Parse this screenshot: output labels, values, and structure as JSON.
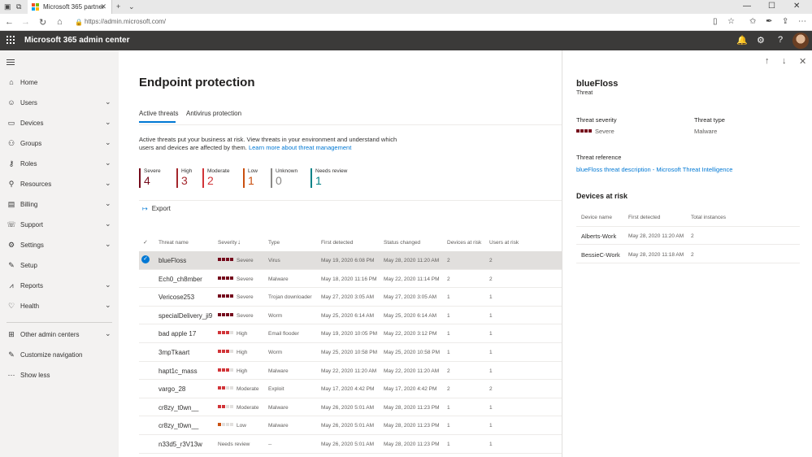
{
  "browser": {
    "tab_title": "Microsoft 365 partner",
    "url": "https://admin.microsoft.com/"
  },
  "header": {
    "app_title": "Microsoft 365 admin center"
  },
  "nav": {
    "items": [
      {
        "label": "Home",
        "icon": "home-icon",
        "glyph": "⌂",
        "chevron": false
      },
      {
        "label": "Users",
        "icon": "user-icon",
        "glyph": "☺",
        "chevron": true
      },
      {
        "label": "Devices",
        "icon": "devices-icon",
        "glyph": "▭",
        "chevron": true
      },
      {
        "label": "Groups",
        "icon": "groups-icon",
        "glyph": "⚇",
        "chevron": true
      },
      {
        "label": "Roles",
        "icon": "roles-icon",
        "glyph": "⚷",
        "chevron": true
      },
      {
        "label": "Resources",
        "icon": "resources-icon",
        "glyph": "⚲",
        "chevron": true
      },
      {
        "label": "Billing",
        "icon": "billing-icon",
        "glyph": "▤",
        "chevron": true
      },
      {
        "label": "Support",
        "icon": "support-icon",
        "glyph": "☏",
        "chevron": true
      },
      {
        "label": "Settings",
        "icon": "settings-icon",
        "glyph": "⚙",
        "chevron": true
      },
      {
        "label": "Setup",
        "icon": "setup-icon",
        "glyph": "✎",
        "chevron": false
      },
      {
        "label": "Reports",
        "icon": "reports-icon",
        "glyph": "⩘",
        "chevron": true
      },
      {
        "label": "Health",
        "icon": "health-icon",
        "glyph": "♡",
        "chevron": true
      },
      {
        "label": "Other admin centers",
        "icon": "admin-centers-icon",
        "glyph": "⊞",
        "chevron": true
      },
      {
        "label": "Customize navigation",
        "icon": "pencil-icon",
        "glyph": "✎",
        "chevron": false
      },
      {
        "label": "Show less",
        "icon": "ellipsis-icon",
        "glyph": "⋯",
        "chevron": false
      }
    ]
  },
  "main": {
    "title": "Endpoint protection",
    "tabs": [
      "Active threats",
      "Antivirus protection"
    ],
    "description": "Active threats put your business at risk. View threats in your environment and understand which users and devices are affected by them.",
    "description_link": "Learn more about threat management",
    "kpis": [
      {
        "label": "Severe",
        "value": "4",
        "color": "#750b1c"
      },
      {
        "label": "High",
        "value": "3",
        "color": "#a4262c"
      },
      {
        "label": "Moderate",
        "value": "2",
        "color": "#d13438"
      },
      {
        "label": "Low",
        "value": "1",
        "color": "#ca5010"
      },
      {
        "label": "Unknown",
        "value": "0",
        "color": "#8a8886"
      },
      {
        "label": "Needs review",
        "value": "1",
        "color": "#038387"
      }
    ],
    "export_label": "Export",
    "columns": [
      "Threat name",
      "Severity",
      "Type",
      "First detected",
      "Status changed",
      "Devices at risk",
      "Users at risk"
    ],
    "sort_indicator": "↓",
    "rows": [
      {
        "name": "blueFloss",
        "severity": "Severe",
        "level": 4,
        "color": "#750b1c",
        "type": "Virus",
        "first": "May 19, 2020 6:08 PM",
        "status": "May 28, 2020 11:20 AM",
        "devices": "2",
        "users": "2",
        "selected": true
      },
      {
        "name": "Ech0_ch8mber",
        "severity": "Severe",
        "level": 4,
        "color": "#750b1c",
        "type": "Malware",
        "first": "May 18, 2020 11:16 PM",
        "status": "May 22, 2020 11:14 PM",
        "devices": "2",
        "users": "2",
        "selected": false
      },
      {
        "name": "Vericose253",
        "severity": "Severe",
        "level": 4,
        "color": "#750b1c",
        "type": "Trojan downloader",
        "first": "May 27, 2020 3:05 AM",
        "status": "May 27, 2020 3:05 AM",
        "devices": "1",
        "users": "1",
        "selected": false
      },
      {
        "name": "specialDelivery_ji9",
        "severity": "Severe",
        "level": 4,
        "color": "#750b1c",
        "type": "Worm",
        "first": "May 25, 2020 6:14 AM",
        "status": "May 25, 2020 6:14 AM",
        "devices": "1",
        "users": "1",
        "selected": false
      },
      {
        "name": "bad apple 17",
        "severity": "High",
        "level": 3,
        "color": "#d13438",
        "type": "Email flooder",
        "first": "May 19, 2020 10:05 PM",
        "status": "May 22, 2020 3:12 PM",
        "devices": "1",
        "users": "1",
        "selected": false
      },
      {
        "name": "3mpTkaart",
        "severity": "High",
        "level": 3,
        "color": "#d13438",
        "type": "Worm",
        "first": "May 25, 2020 10:58 PM",
        "status": "May 25, 2020 10:58 PM",
        "devices": "1",
        "users": "1",
        "selected": false
      },
      {
        "name": "hapt1c_mass",
        "severity": "High",
        "level": 3,
        "color": "#d13438",
        "type": "Malware",
        "first": "May 22, 2020 11:20 AM",
        "status": "May 22, 2020 11:20 AM",
        "devices": "2",
        "users": "1",
        "selected": false
      },
      {
        "name": "vargo_28",
        "severity": "Moderate",
        "level": 2,
        "color": "#d13438",
        "type": "Exploit",
        "first": "May 17, 2020 4:42 PM",
        "status": "May 17, 2020 4:42 PM",
        "devices": "2",
        "users": "2",
        "selected": false
      },
      {
        "name": "cr8zy_t0wn__",
        "severity": "Moderate",
        "level": 2,
        "color": "#d13438",
        "type": "Malware",
        "first": "May 26, 2020 5:01 AM",
        "status": "May 28, 2020 11:23 PM",
        "devices": "1",
        "users": "1",
        "selected": false
      },
      {
        "name": "cr8zy_t0wn__",
        "severity": "Low",
        "level": 1,
        "color": "#ca5010",
        "type": "Malware",
        "first": "May 26, 2020 5:01 AM",
        "status": "May 28, 2020 11:23 PM",
        "devices": "1",
        "users": "1",
        "selected": false
      },
      {
        "name": "n33d5_r3V13w",
        "severity": "Needs review",
        "level": 0,
        "color": "#038387",
        "type": "--",
        "first": "May 26, 2020 5:01 AM",
        "status": "May 28, 2020 11:23 PM",
        "devices": "1",
        "users": "1",
        "selected": false
      }
    ]
  },
  "panel": {
    "title": "blueFloss",
    "subtitle": "Threat",
    "severity_label": "Threat severity",
    "severity_value": "Severe",
    "type_label": "Threat type",
    "type_value": "Malware",
    "reference_label": "Threat reference",
    "reference_link": "blueFloss threat description - Microsoft Threat Intelligence",
    "devices_heading": "Devices at risk",
    "device_columns": [
      "Device name",
      "First detected",
      "Total instances"
    ],
    "devices": [
      {
        "name": "Alberts-Work",
        "first": "May 28, 2020 11:20 AM",
        "count": "2"
      },
      {
        "name": "BessieC-Work",
        "first": "May 28, 2020 11:18 AM",
        "count": "2"
      }
    ]
  }
}
